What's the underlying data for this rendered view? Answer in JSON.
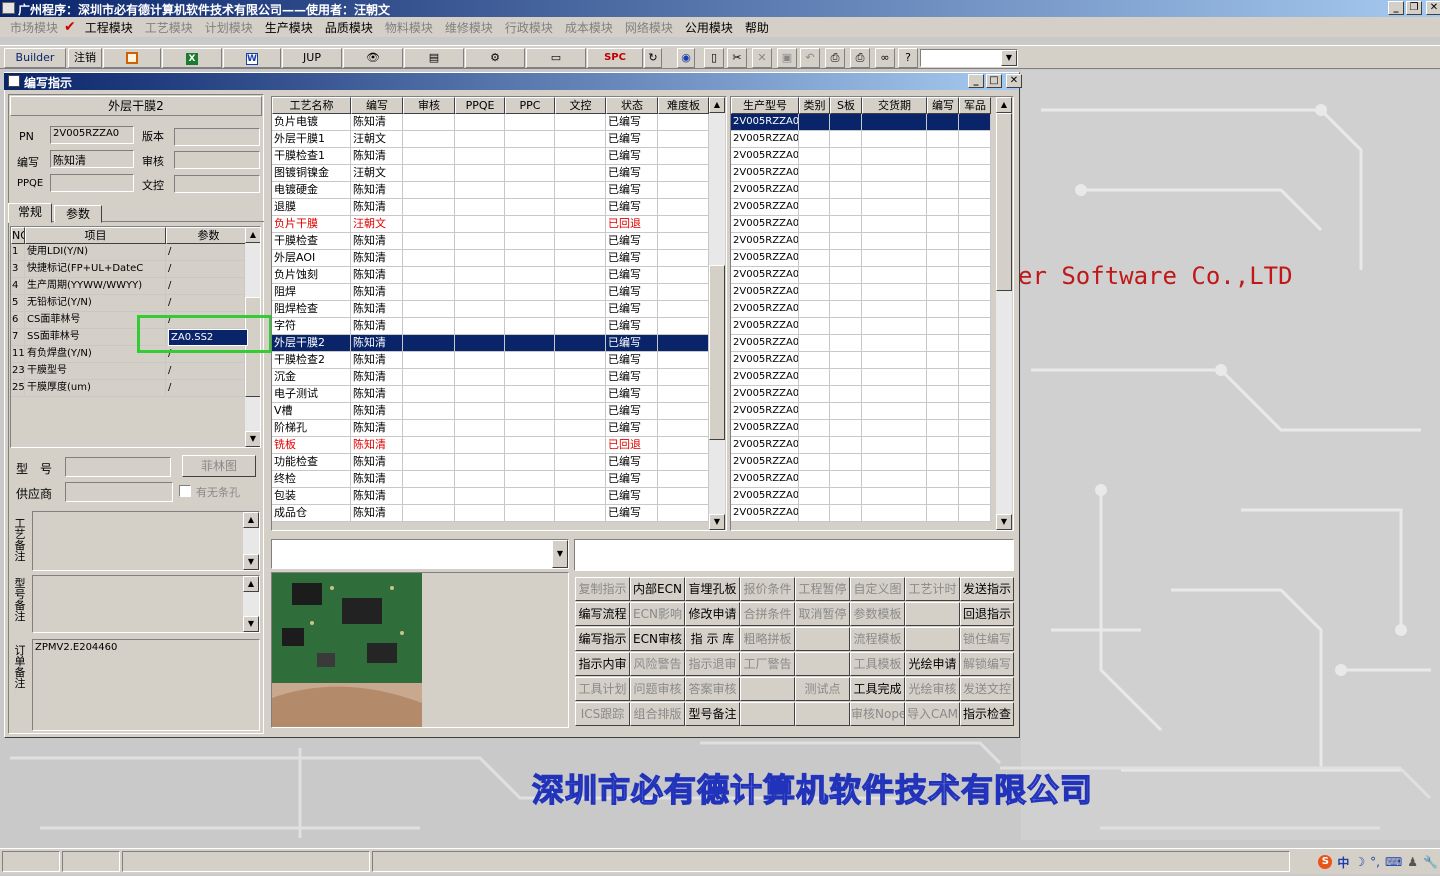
{
  "window": {
    "title": "广州程序：深圳市必有德计算机软件技术有限公司——使用者：汪朝文"
  },
  "menu": [
    {
      "label": "市场模块",
      "disabled": true
    },
    {
      "label": "工程模块",
      "disabled": false,
      "checked": true
    },
    {
      "label": "工艺模块",
      "disabled": true
    },
    {
      "label": "计划模块",
      "disabled": true
    },
    {
      "label": "生产模块",
      "disabled": false
    },
    {
      "label": "品质模块",
      "disabled": false
    },
    {
      "label": "物料模块",
      "disabled": true
    },
    {
      "label": "维修模块",
      "disabled": true
    },
    {
      "label": "行政模块",
      "disabled": true
    },
    {
      "label": "成本模块",
      "disabled": true
    },
    {
      "label": "网络模块",
      "disabled": true
    },
    {
      "label": "公用模块",
      "disabled": false
    },
    {
      "label": "帮助",
      "disabled": false
    }
  ],
  "toolbar": {
    "builder": "Builder",
    "logout": "注销",
    "jup": "JUP",
    "spc": "SPC"
  },
  "background": {
    "brand": "er Software Co.,LTD",
    "company": "深圳市必有德计算机软件技术有限公司"
  },
  "subwindow": {
    "title": "编写指示"
  },
  "left_panel": {
    "section_title": "外层干膜2",
    "pn_label": "PN",
    "pn_value": "2V005RZZA0",
    "version_label": "版本",
    "version_value": "",
    "writer_label": "编写",
    "writer_value": "陈知清",
    "review_label": "审核",
    "review_value": "",
    "ppqe_label": "PPQE",
    "ppqe_value": "",
    "doc_label": "文控",
    "doc_value": "",
    "tabs": [
      "常规",
      "参数"
    ],
    "param_headers": [
      "NO",
      "项目",
      "参数"
    ],
    "params": [
      {
        "no": "1",
        "item": "使用LDI(Y/N)",
        "value": "/"
      },
      {
        "no": "3",
        "item": "快捷标记(FP+UL+DateC",
        "value": "/"
      },
      {
        "no": "4",
        "item": "生产周期(YYWW/WWYY)",
        "value": "/"
      },
      {
        "no": "5",
        "item": "无铅标记(Y/N)",
        "value": "/"
      },
      {
        "no": "6",
        "item": "CS面菲林号",
        "value": "/"
      },
      {
        "no": "7",
        "item": "SS面菲林号",
        "value": "ZA0.SS2",
        "editing": true
      },
      {
        "no": "11",
        "item": "有负焊盘(Y/N)",
        "value": "/"
      },
      {
        "no": "23",
        "item": "干膜型号",
        "value": "/"
      },
      {
        "no": "25",
        "item": "干膜厚度(um)",
        "value": "/"
      }
    ],
    "model_label": "型　号",
    "model_value": "",
    "film_btn": "菲林图",
    "supplier_label": "供应商",
    "supplier_value": "",
    "hole_check": "有无条孔",
    "process_note_label": "工艺备注",
    "model_note_label": "型号备注",
    "order_note_label": "订单备注",
    "order_note_value": "ZPMV2.E204460"
  },
  "process_grid": {
    "headers": [
      "工艺名称",
      "编写",
      "审核",
      "PPQE",
      "PPC",
      "文控",
      "状态",
      "难度板"
    ],
    "rows": [
      {
        "name": "负片电镀",
        "writer": "陈知清",
        "status": "已编写"
      },
      {
        "name": "外层干膜1",
        "writer": "汪朝文",
        "status": "已编写"
      },
      {
        "name": "干膜检查1",
        "writer": "陈知清",
        "status": "已编写"
      },
      {
        "name": "图镀铜镍金",
        "writer": "汪朝文",
        "status": "已编写"
      },
      {
        "name": "电镀硬金",
        "writer": "陈知清",
        "status": "已编写"
      },
      {
        "name": "退膜",
        "writer": "陈知清",
        "status": "已编写"
      },
      {
        "name": "负片干膜",
        "writer": "汪朝文",
        "status": "已回退",
        "red": true
      },
      {
        "name": "干膜检查",
        "writer": "陈知清",
        "status": "已编写"
      },
      {
        "name": "外层AOI",
        "writer": "陈知清",
        "status": "已编写"
      },
      {
        "name": "负片蚀刻",
        "writer": "陈知清",
        "status": "已编写"
      },
      {
        "name": "阻焊",
        "writer": "陈知清",
        "status": "已编写"
      },
      {
        "name": "阻焊检查",
        "writer": "陈知清",
        "status": "已编写"
      },
      {
        "name": "字符",
        "writer": "陈知清",
        "status": "已编写"
      },
      {
        "name": "外层干膜2",
        "writer": "陈知清",
        "status": "已编写",
        "selected": true
      },
      {
        "name": "干膜检查2",
        "writer": "陈知清",
        "status": "已编写"
      },
      {
        "name": "沉金",
        "writer": "陈知清",
        "status": "已编写"
      },
      {
        "name": "电子测试",
        "writer": "陈知清",
        "status": "已编写"
      },
      {
        "name": "V槽",
        "writer": "陈知清",
        "status": "已编写"
      },
      {
        "name": "阶梯孔",
        "writer": "陈知清",
        "status": "已编写"
      },
      {
        "name": "铣板",
        "writer": "陈知清",
        "status": "已回退",
        "red": true
      },
      {
        "name": "功能检查",
        "writer": "陈知清",
        "status": "已编写"
      },
      {
        "name": "终检",
        "writer": "陈知清",
        "status": "已编写"
      },
      {
        "name": "包装",
        "writer": "陈知清",
        "status": "已编写"
      },
      {
        "name": "成品仓",
        "writer": "陈知清",
        "status": "已编写"
      }
    ]
  },
  "model_grid": {
    "headers": [
      "生产型号",
      "类别",
      "S板",
      "交货期",
      "编写",
      "军品"
    ],
    "value": "2V005RZZA0",
    "row_count": 24
  },
  "action_buttons": [
    [
      {
        "label": "复制指示",
        "disabled": true
      },
      {
        "label": "内部ECN",
        "disabled": false
      },
      {
        "label": "盲埋孔板",
        "disabled": false
      },
      {
        "label": "报价条件",
        "disabled": true
      },
      {
        "label": "工程暂停",
        "disabled": true
      },
      {
        "label": "自定义图",
        "disabled": true
      },
      {
        "label": "工艺计时",
        "disabled": true
      },
      {
        "label": "发送指示",
        "disabled": false
      }
    ],
    [
      {
        "label": "编写流程",
        "disabled": false
      },
      {
        "label": "ECN影响",
        "disabled": true
      },
      {
        "label": "修改申请",
        "disabled": false
      },
      {
        "label": "合拼条件",
        "disabled": true
      },
      {
        "label": "取消暂停",
        "disabled": true
      },
      {
        "label": "参数模板",
        "disabled": true
      },
      {
        "label": "",
        "disabled": true
      },
      {
        "label": "回退指示",
        "disabled": false
      }
    ],
    [
      {
        "label": "编写指示",
        "disabled": false
      },
      {
        "label": "ECN审核",
        "disabled": false
      },
      {
        "label": "指 示 库",
        "disabled": false
      },
      {
        "label": "粗略拼板",
        "disabled": true
      },
      {
        "label": "",
        "disabled": true
      },
      {
        "label": "流程模板",
        "disabled": true
      },
      {
        "label": "",
        "disabled": true
      },
      {
        "label": "锁住编写",
        "disabled": true
      }
    ],
    [
      {
        "label": "指示内审",
        "disabled": false
      },
      {
        "label": "风险警告",
        "disabled": true
      },
      {
        "label": "指示退审",
        "disabled": true
      },
      {
        "label": "工厂警告",
        "disabled": true
      },
      {
        "label": "",
        "disabled": true
      },
      {
        "label": "工具模板",
        "disabled": true
      },
      {
        "label": "光绘申请",
        "disabled": false
      },
      {
        "label": "解锁编写",
        "disabled": true
      }
    ],
    [
      {
        "label": "工具计划",
        "disabled": true
      },
      {
        "label": "问题审核",
        "disabled": true
      },
      {
        "label": "答案审核",
        "disabled": true
      },
      {
        "label": "",
        "disabled": true
      },
      {
        "label": "测试点",
        "disabled": true
      },
      {
        "label": "工具完成",
        "disabled": false
      },
      {
        "label": "光绘审核",
        "disabled": true
      },
      {
        "label": "发送文控",
        "disabled": true
      }
    ],
    [
      {
        "label": "ICS跟踪",
        "disabled": true
      },
      {
        "label": "组合排版",
        "disabled": true
      },
      {
        "label": "型号备注",
        "disabled": false
      },
      {
        "label": "",
        "disabled": true
      },
      {
        "label": "",
        "disabled": true
      },
      {
        "label": "审核Nope",
        "disabled": true
      },
      {
        "label": "导入CAM",
        "disabled": true
      },
      {
        "label": "指示检查",
        "disabled": false
      }
    ]
  ],
  "tray": {
    "ime": "中"
  }
}
